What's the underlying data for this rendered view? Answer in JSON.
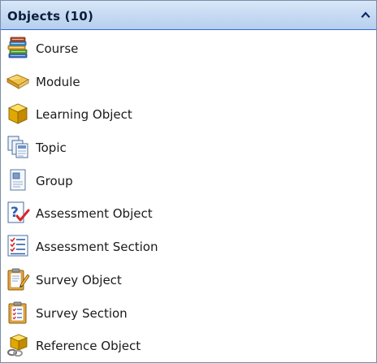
{
  "panel": {
    "title": "Objects (10)",
    "collapse_icon": "chevron-up-icon"
  },
  "items": [
    {
      "label": "Course",
      "icon": "books-stack-icon"
    },
    {
      "label": "Module",
      "icon": "open-book-icon"
    },
    {
      "label": "Learning Object",
      "icon": "cube-icon"
    },
    {
      "label": "Topic",
      "icon": "document-pages-icon"
    },
    {
      "label": "Group",
      "icon": "group-page-icon"
    },
    {
      "label": "Assessment Object",
      "icon": "question-check-icon"
    },
    {
      "label": "Assessment Section",
      "icon": "checklist-icon"
    },
    {
      "label": "Survey Object",
      "icon": "clipboard-pencil-icon"
    },
    {
      "label": "Survey Section",
      "icon": "clipboard-list-icon"
    },
    {
      "label": "Reference Object",
      "icon": "cube-link-icon"
    }
  ],
  "colors": {
    "header_gradient_top": "#d9e7f8",
    "header_gradient_bottom": "#b6cfee",
    "header_border": "#2f6dd6",
    "title_text": "#0b1e3a",
    "item_text": "#1a1a1a"
  }
}
